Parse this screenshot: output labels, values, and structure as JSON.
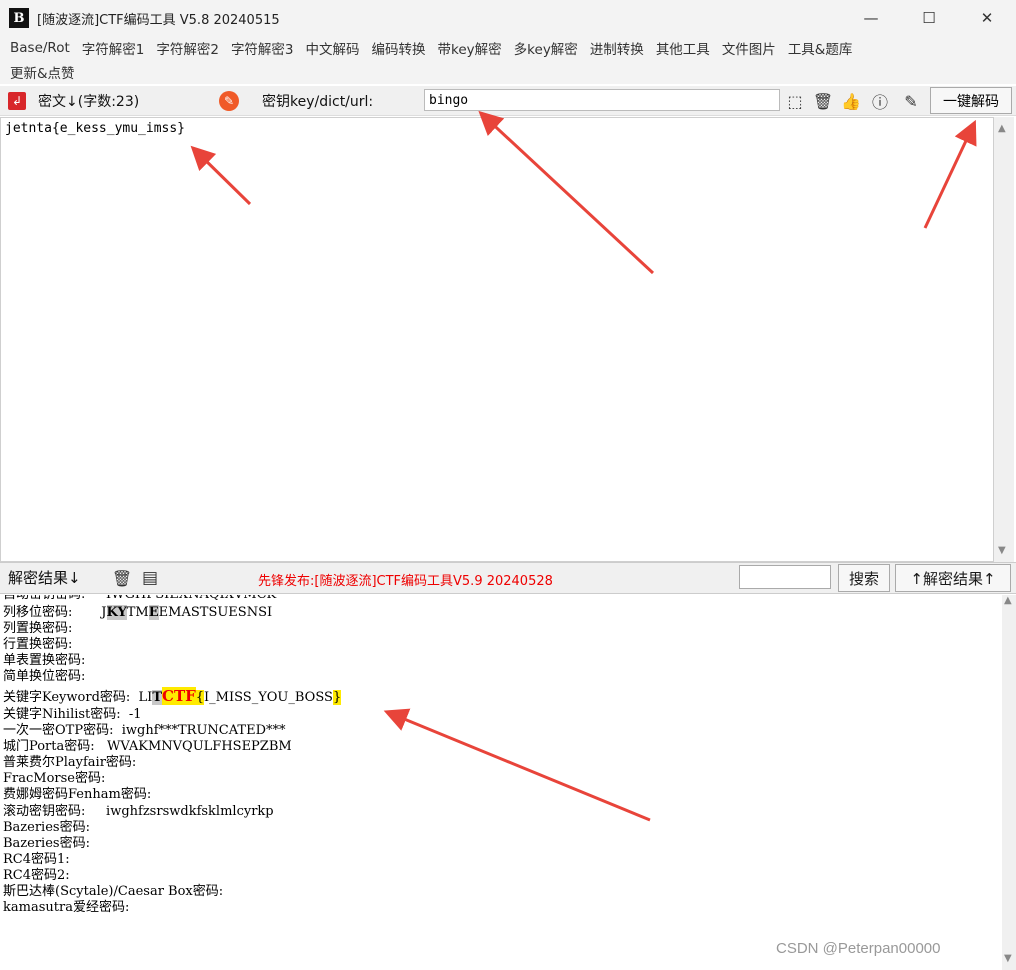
{
  "window": {
    "title": "[随波逐流]CTF编码工具 V5.8 20240515",
    "app_icon": "B",
    "minimize": "—",
    "maximize": "☐",
    "close": "✕"
  },
  "menu": {
    "row1": [
      "Base/Rot",
      "字符解密1",
      "字符解密2",
      "字符解密3",
      "中文解码",
      "编码转换",
      "带key解密",
      "多key解密",
      "进制转换",
      "其他工具",
      "文件图片",
      "工具&题库"
    ],
    "row2": [
      "更新&点赞"
    ]
  },
  "toolbar": {
    "cipher_label": "密文↓(字数:23)",
    "key_label": "密钥key/dict/url:",
    "key_value": "bingo",
    "decode_all_label": "一键解码"
  },
  "cipher_text": "jetnta{e_kess_ymu_imss}",
  "result_toolbar": {
    "label": "解密结果↓",
    "notice": "先锋发布:[随波逐流]CTF编码工具V5.9 20240528",
    "search_label": "搜索",
    "result_up_label": "↑解密结果↑"
  },
  "results": {
    "l0": "自动密钥密码:     IWGHFSIEXNAQIXVMCK",
    "l1a": "列移位密码:       J",
    "l1b": "KY",
    "l1c": "TM",
    "l1d": "E",
    "l1e": "EMASTSUESNSI",
    "l2": "列置换密码:",
    "l3": "行置换密码:",
    "l4": "单表置换密码:",
    "l5": "简单换位密码:",
    "l6a": "关键字Keyword密码:  LI",
    "l6b": "T",
    "l6c": "CTF",
    "l6d": "{",
    "l6e": "I_MISS_YOU_BOSS",
    "l6f": "}",
    "l7": "关键字Nihilist密码:  -1",
    "l8": "一次一密OTP密码:  iwghf***TRUNCATED***",
    "l9": "城门Porta密码:   WVAKMNVQULFHSEPZBM",
    "l10": "普莱费尔Playfair密码:",
    "l11": "FracMorse密码:",
    "l12": "费娜姆密码Fenham密码:",
    "l13": "滚动密钥密码:     iwghfzsrswdkfsklmlcyrkp",
    "l14": "Bazeries密码:",
    "l15": "Bazeries密码:",
    "l16": "RC4密码1:",
    "l17": "RC4密码2:",
    "l18": "斯巴达棒(Scytale)/Caesar Box密码:",
    "l19": "kamasutra爱经密码:"
  },
  "watermark": "CSDN @Peterpan00000",
  "colors": {
    "arrow": "#e8443a",
    "highlight": "#ffea00",
    "notice": "#ee0000"
  }
}
